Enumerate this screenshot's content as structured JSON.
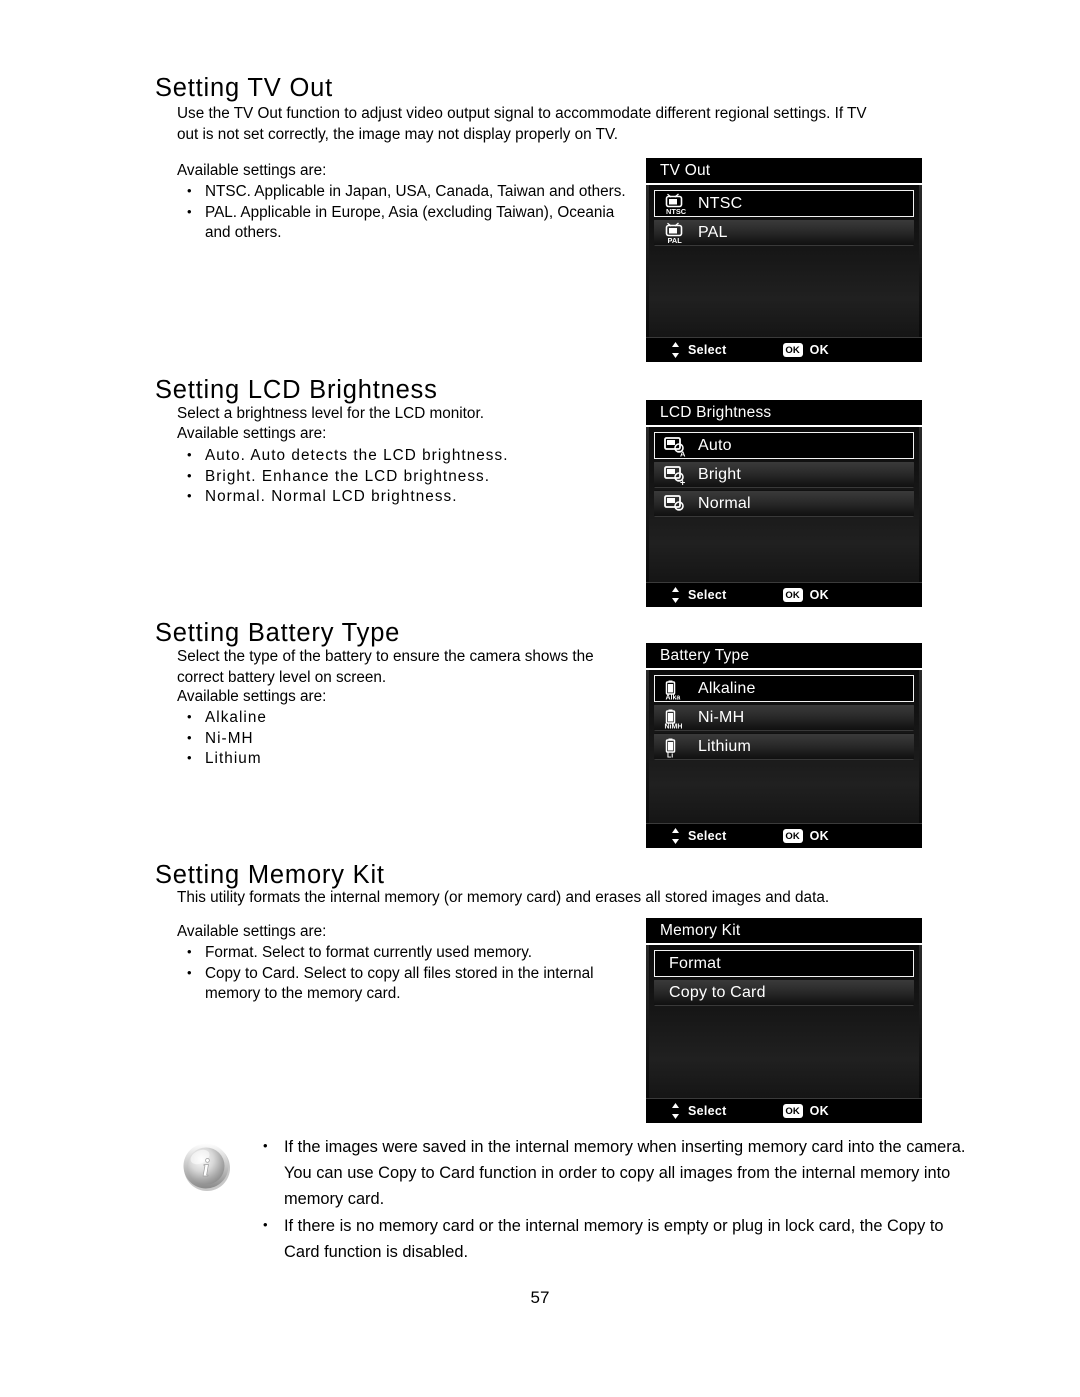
{
  "page": {
    "number": "57"
  },
  "sections": [
    {
      "id": "tv-out",
      "title": "Setting TV Out",
      "intro": "Use the TV Out function to adjust video output signal to accommodate different regional settings. If TV out is not set correctly, the image may not display properly on TV.",
      "lead": "Available settings are:",
      "bullets": [
        "NTSC. Applicable in Japan, USA, Canada, Taiwan and others.",
        "PAL. Applicable in Europe, Asia (excluding Taiwan), Oceania and others."
      ],
      "screen": {
        "title": "TV Out",
        "options": [
          {
            "label": "NTSC",
            "icon": "tv-ntsc-icon",
            "icon_text": "NTSC",
            "selected": true
          },
          {
            "label": "PAL",
            "icon": "tv-pal-icon",
            "icon_text": "PAL",
            "selected": false
          }
        ],
        "footer": {
          "select_label": "Select",
          "ok_badge": "OK",
          "ok_label": "OK"
        }
      }
    },
    {
      "id": "lcd-brightness",
      "title": "Setting LCD Brightness",
      "intro": "Select a brightness level for the LCD monitor.",
      "lead": "Available settings are:",
      "bullets": [
        "Auto. Auto detects the LCD brightness.",
        "Bright. Enhance the LCD brightness.",
        "Normal. Normal LCD brightness."
      ],
      "bullet_terms": [
        "Auto",
        "Bright",
        "Normal"
      ],
      "screen": {
        "title": "LCD Brightness",
        "options": [
          {
            "label": "Auto",
            "icon": "lcd-auto-icon",
            "icon_text": "A",
            "selected": true
          },
          {
            "label": "Bright",
            "icon": "lcd-bright-icon",
            "icon_text": "+",
            "selected": false
          },
          {
            "label": "Normal",
            "icon": "lcd-normal-icon",
            "icon_text": "-",
            "selected": false
          }
        ],
        "footer": {
          "select_label": "Select",
          "ok_badge": "OK",
          "ok_label": "OK"
        }
      }
    },
    {
      "id": "battery-type",
      "title": "Setting Battery Type",
      "intro": "Select the type of the battery to ensure the camera shows the correct battery level on screen.",
      "lead": "Available settings are:",
      "bullets": [
        "Alkaline",
        "Ni-MH",
        "Lithium"
      ],
      "screen": {
        "title": "Battery Type",
        "options": [
          {
            "label": "Alkaline",
            "icon": "battery-alkaline-icon",
            "icon_text": "Alka",
            "selected": true
          },
          {
            "label": "Ni-MH",
            "icon": "battery-nimh-icon",
            "icon_text": "NiMH",
            "selected": false
          },
          {
            "label": "Lithium",
            "icon": "battery-lithium-icon",
            "icon_text": "Li",
            "selected": false
          }
        ],
        "footer": {
          "select_label": "Select",
          "ok_badge": "OK",
          "ok_label": "OK"
        }
      }
    },
    {
      "id": "memory-kit",
      "title": "Setting Memory Kit",
      "intro": "This utility formats the internal memory (or memory card) and erases all stored images and data.",
      "lead": "Available settings are:",
      "bullets": [
        "Format. Select to format currently used memory.",
        "Copy to Card. Select to copy all files stored in the internal memory to the memory card."
      ],
      "screen": {
        "title": "Memory Kit",
        "options": [
          {
            "label": "Format",
            "icon": null,
            "selected": true
          },
          {
            "label": "Copy to Card",
            "icon": null,
            "selected": false
          }
        ],
        "footer": {
          "select_label": "Select",
          "ok_badge": "OK",
          "ok_label": "OK"
        }
      }
    }
  ],
  "note": {
    "icon": "info-icon",
    "items": [
      "If the images were saved in the internal memory when inserting memory card into the camera. You can use Copy to Card function in order to copy all images from the internal memory into memory card.",
      "If there is no memory card or the internal memory is empty or plug in lock card, the Copy to Card function is disabled."
    ]
  }
}
